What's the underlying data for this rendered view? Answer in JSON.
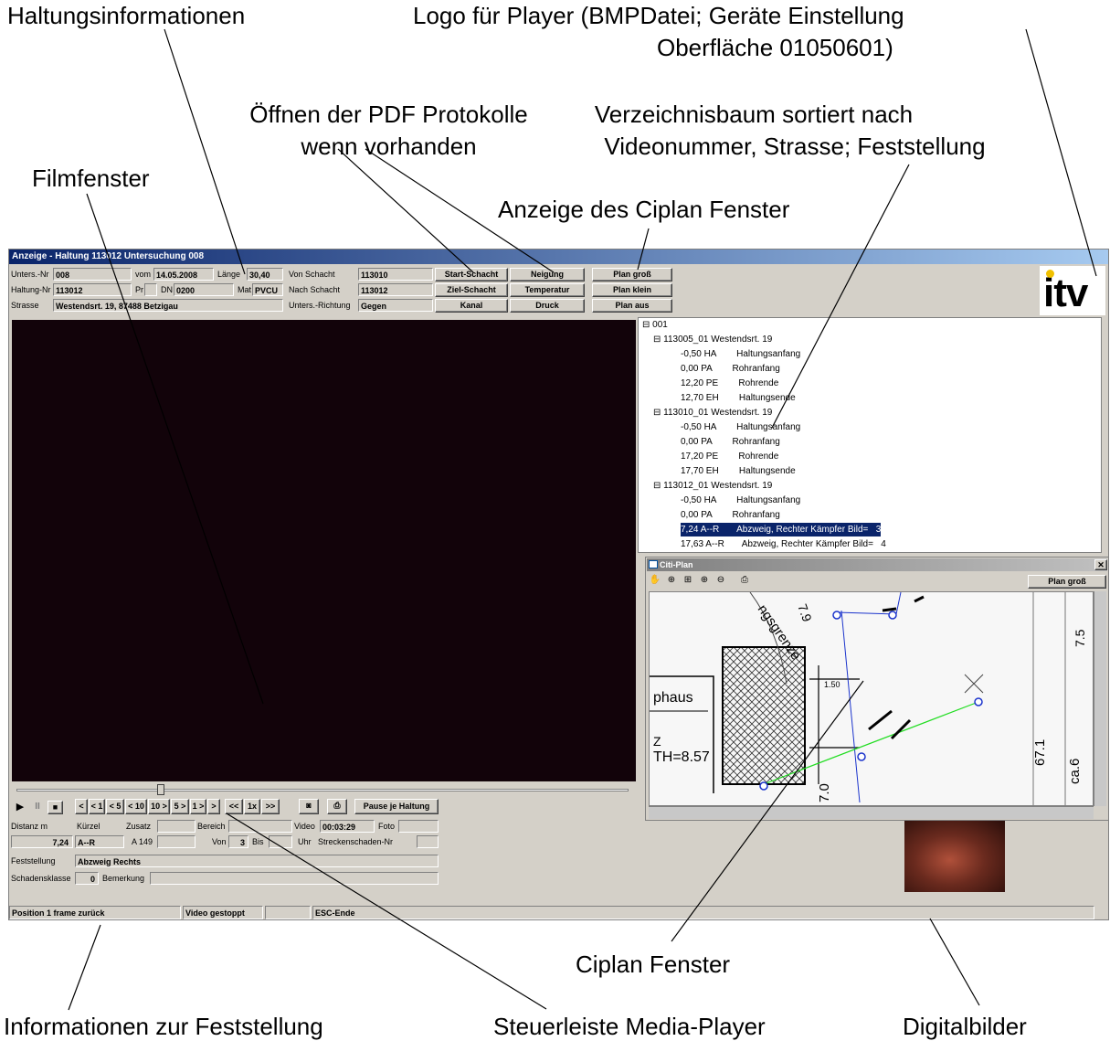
{
  "annotations": {
    "haltungsinfo": "Haltungsinformationen",
    "logo_line1": "Logo für Player (BMPDatei; Geräte Einstellung",
    "logo_line2": "Oberfläche 01050601)",
    "pdf_line1": "Öffnen der PDF Protokolle",
    "pdf_line2": "wenn vorhanden",
    "tree_line1": "Verzeichnisbaum sortiert nach",
    "tree_line2": "Videonummer, Strasse; Feststellung",
    "filmfenster": "Filmfenster",
    "ciplan_anzeige": "Anzeige des Ciplan Fenster",
    "ciplan_fenster": "Ciplan Fenster",
    "feststellung_info": "Informationen zur Feststellung",
    "steuerleiste": "Steuerleiste Media-Player",
    "digitalbilder": "Digitalbilder"
  },
  "window": {
    "title": "Anzeige - Haltung 113012 Untersuchung 008"
  },
  "header": {
    "unters_nr_label": "Unters.-Nr",
    "unters_nr": "008",
    "vom_label": "vom",
    "vom": "14.05.2008",
    "laenge_label": "Länge",
    "laenge": "30,40",
    "von_schacht_label": "Von Schacht",
    "von_schacht": "113010",
    "haltung_nr_label": "Haltung-Nr",
    "haltung_nr": "113012",
    "pr_label": "Pr",
    "pr": "",
    "dn_label": "DN",
    "dn": "0200",
    "mat_label": "Mat",
    "mat": "PVCU",
    "nach_schacht_label": "Nach Schacht",
    "nach_schacht": "113012",
    "strasse_label": "Strasse",
    "strasse": "Westendsrt. 19, 87488 Betzigau",
    "richtung_label": "Unters.-Richtung",
    "richtung": "Gegen"
  },
  "buttons": {
    "start_schacht": "Start-Schacht",
    "neigung": "Neigung",
    "plan_gross": "Plan groß",
    "ziel_schacht": "Ziel-Schacht",
    "temperatur": "Temperatur",
    "plan_klein": "Plan klein",
    "kanal": "Kanal",
    "druck": "Druck",
    "plan_aus": "Plan aus"
  },
  "logo": {
    "text": "itv",
    "dot_color": "#f0c000"
  },
  "tree": {
    "root": "001",
    "nodes": [
      "113005_01 Westendsrt. 19",
      "-0,50 HA        Haltungsanfang",
      "0,00 PA        Rohranfang",
      "12,20 PE        Rohrende",
      "12,70 EH        Haltungsende",
      "113010_01 Westendsrt. 19",
      "-0,50 HA        Haltungsanfang",
      "0,00 PA        Rohranfang",
      "17,20 PE        Rohrende",
      "17,70 EH        Haltungsende",
      "113012_01 Westendsrt. 19",
      "-0,50 HA        Haltungsanfang",
      "0,00 PA        Rohranfang",
      "7,24 A--R       Abzweig, Rechter Kämpfer Bild=   3",
      "17,63 A--R       Abzweig, Rechter Kämpfer Bild=   4"
    ]
  },
  "citiplan": {
    "title": "Citi-Plan",
    "plan_gross": "Plan groß",
    "map_texts": {
      "haus": "phaus",
      "th": "TH=8.57",
      "z": "Z",
      "val1": "1.50",
      "val2": "7.9",
      "val3": "67.1",
      "val4": "ca.6",
      "val5": "7.0",
      "grenze": "ngsgrenze",
      "val6": "7.5"
    }
  },
  "controls": {
    "play": "▶",
    "pause": "II",
    "stop": "■",
    "nav": [
      "<",
      "< 1",
      "< 5",
      "< 10",
      "10 >",
      "5 >",
      "1 >",
      ">",
      "<<",
      "1x",
      ">>"
    ],
    "pause_haltung": "Pause je Haltung"
  },
  "details": {
    "distanz_label": "Distanz  m",
    "distanz": "7,24",
    "kuerzel_label": "Kürzel",
    "kuerzel": "A--R",
    "zusatz_label": "Zusatz",
    "zusatz_sub": "A 149",
    "bereich_label": "Bereich",
    "von_label": "Von",
    "von": "3",
    "bis_label": "Bis",
    "video_label": "Video",
    "video": "00:03:29",
    "foto_label": "Foto",
    "uhr_label": "Uhr",
    "strecke_label": "Streckenschaden-Nr",
    "feststellung_label": "Feststellung",
    "feststellung": "Abzweig Rechts",
    "schadensklasse_label": "Schadensklasse",
    "schadensklasse": "0",
    "bemerkung_label": "Bemerkung"
  },
  "status": {
    "s1": "Position 1 frame zurück",
    "s2": "Video gestoppt",
    "s3": "ESC-Ende"
  }
}
